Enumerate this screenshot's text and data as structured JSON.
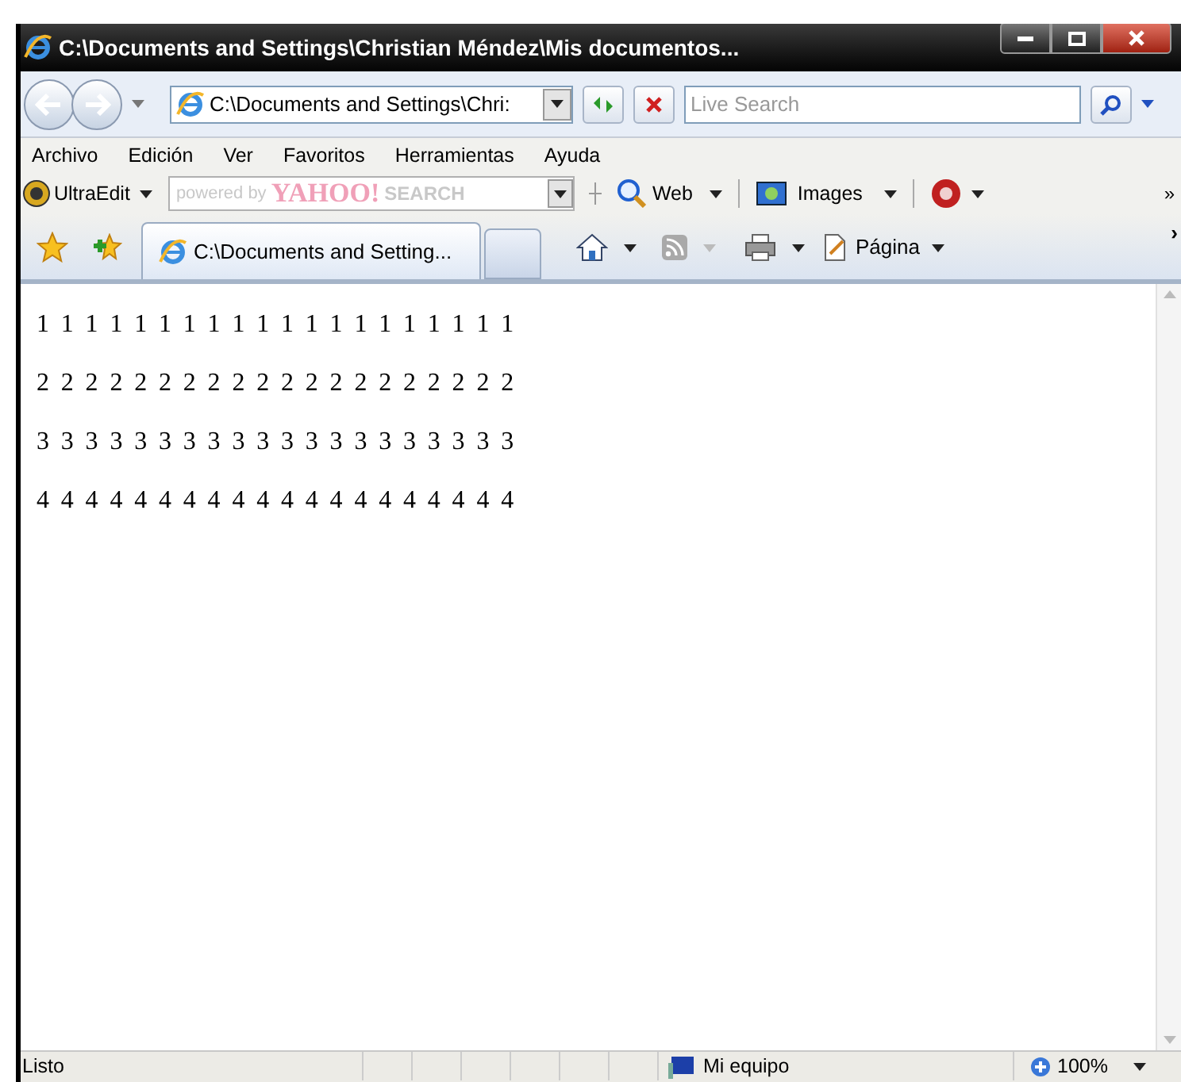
{
  "window": {
    "title": "C:\\Documents and Settings\\Christian Méndez\\Mis documentos..."
  },
  "address_bar": {
    "value": "C:\\Documents and Settings\\Chri:"
  },
  "search": {
    "placeholder": "Live Search"
  },
  "menu": [
    "Archivo",
    "Edición",
    "Ver",
    "Favoritos",
    "Herramientas",
    "Ayuda"
  ],
  "links_toolbar": {
    "ultraedit": "UltraEdit",
    "search_placeholder": "powered by",
    "search_brand": "YAHOO!",
    "search_word": "SEARCH",
    "web": "Web",
    "images": "Images",
    "more": "»"
  },
  "tabs": [
    {
      "label": "C:\\Documents and Setting...",
      "selected": true
    }
  ],
  "command_bar": {
    "page": "Página",
    "more": "›"
  },
  "content": {
    "lines": [
      "1 1 1 1 1 1 1 1 1 1 1 1 1 1 1 1 1 1 1 1",
      "2 2 2 2 2 2 2 2 2 2 2 2 2 2 2 2 2 2 2 2",
      "3 3 3 3 3 3 3 3 3 3 3 3 3 3 3 3 3 3 3 3",
      "4 4 4 4 4 4 4 4 4 4 4 4 4 4 4 4 4 4 4 4"
    ]
  },
  "status_bar": {
    "status": "Listo",
    "zone": "Mi equipo",
    "zoom": "100%"
  }
}
